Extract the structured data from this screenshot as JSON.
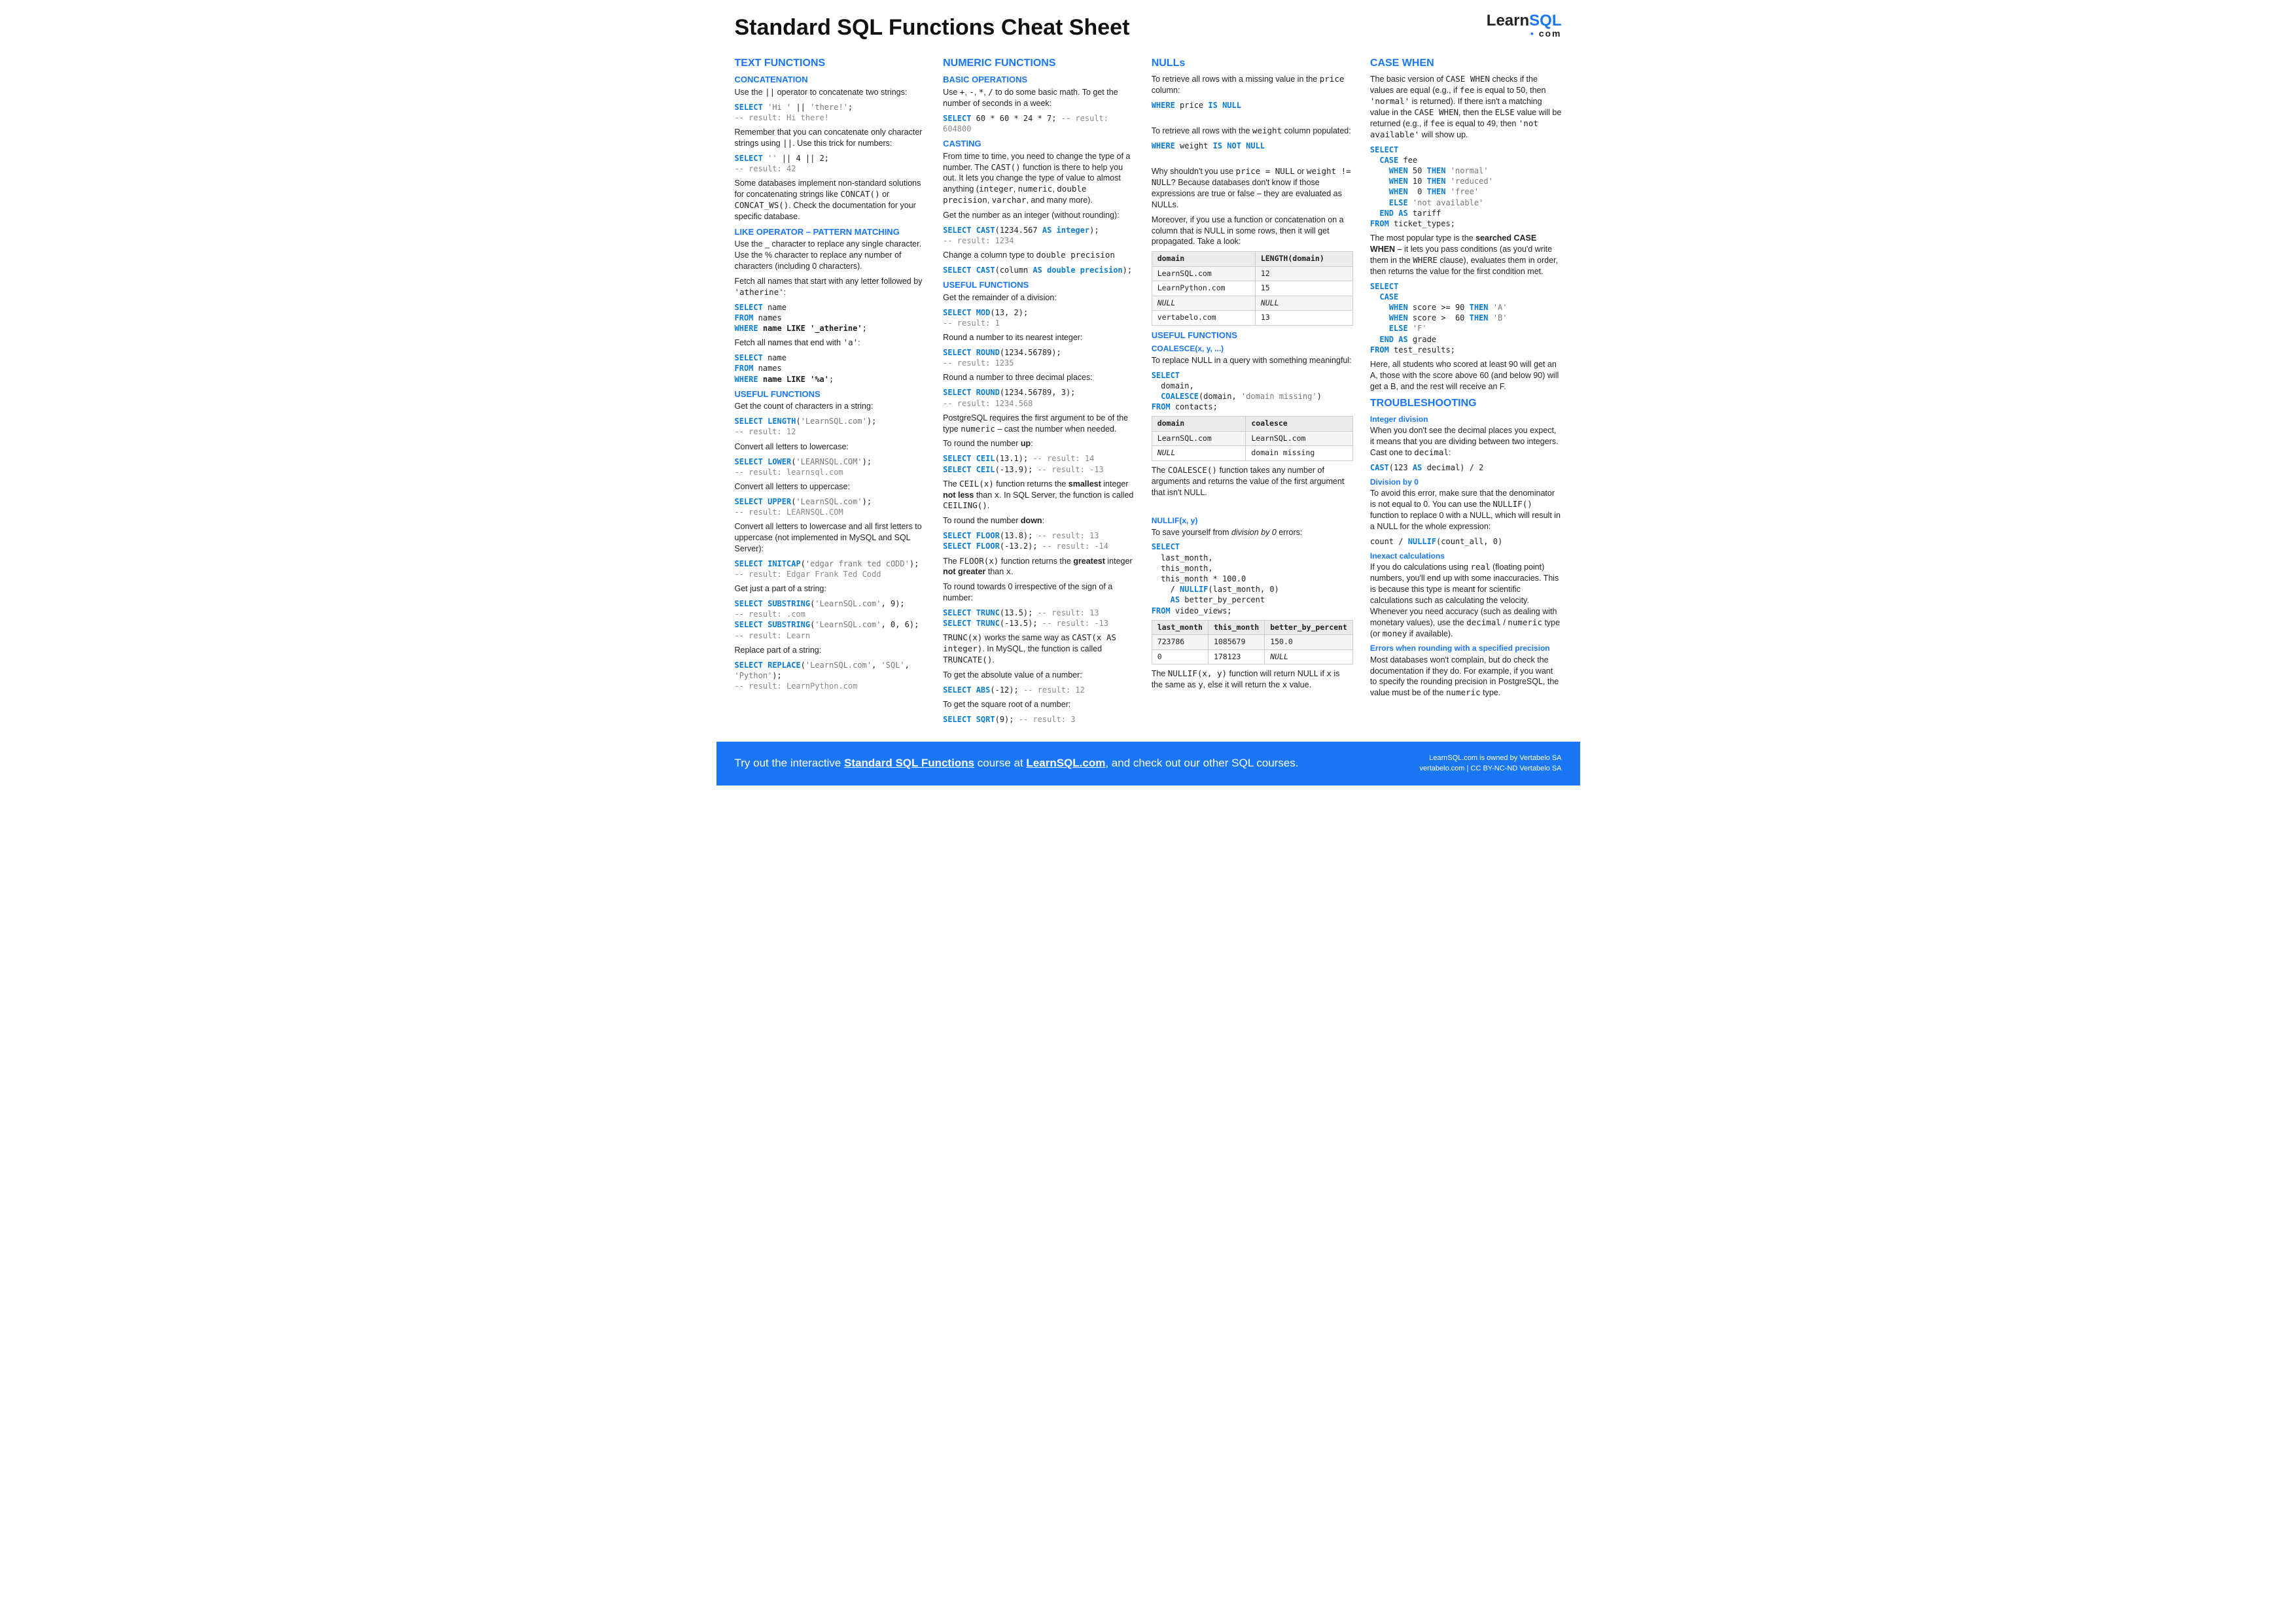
{
  "header": {
    "title": "Standard SQL Functions Cheat Sheet",
    "logo_main_pre": "Learn",
    "logo_main_blue": "SQL",
    "logo_sub": "com"
  },
  "col1": {
    "h_text": "TEXT FUNCTIONS",
    "h_concat": "CONCATENATION",
    "concat_p1": "Use the || operator to concatenate two strings:",
    "concat_code1": "SELECT 'Hi ' || 'there!';\n-- result: Hi there!",
    "concat_p2a": "Remember that you can concatenate only character strings using ",
    "concat_p2b": ". Use this trick for numbers:",
    "concat_code2": "SELECT '' || 4 || 2;\n-- result: 42",
    "concat_p3": "Some databases implement non-standard solutions for concatenating strings like CONCAT() or CONCAT_WS(). Check the documentation for your specific database.",
    "h_like": "LIKE OPERATOR – PATTERN MATCHING",
    "like_p1": "Use the _ character to replace any single character. Use the % character to replace any number of characters (including 0 characters).",
    "like_p2": "Fetch all names that start with any letter followed by 'atherine':",
    "like_code1": "SELECT name\nFROM names\nWHERE name LIKE '_atherine';",
    "like_p3": "Fetch all names that end with 'a':",
    "like_code2": "SELECT name\nFROM names\nWHERE name LIKE '%a';",
    "h_useful": "USEFUL FUNCTIONS",
    "u1_p": "Get the count of characters in a string:",
    "u1_c": "SELECT LENGTH('LearnSQL.com');\n-- result: 12",
    "u2_p": "Convert all letters to lowercase:",
    "u2_c": "SELECT LOWER('LEARNSQL.COM');\n-- result: learnsql.com",
    "u3_p": "Convert all letters to uppercase:",
    "u3_c": "SELECT UPPER('LearnSQL.com');\n-- result: LEARNSQL.COM",
    "u4_p": "Convert all letters to lowercase and all first letters to uppercase (not implemented in MySQL and SQL Server):",
    "u4_c": "SELECT INITCAP('edgar frank ted cODD');\n-- result: Edgar Frank Ted Codd",
    "u5_p": "Get just a part of a string:",
    "u5_c": "SELECT SUBSTRING('LearnSQL.com', 9);\n-- result: .com\nSELECT SUBSTRING('LearnSQL.com', 0, 6);\n-- result: Learn",
    "u6_p": "Replace part of a string:",
    "u6_c": "SELECT REPLACE('LearnSQL.com', 'SQL', 'Python');\n-- result: LearnPython.com"
  },
  "col2": {
    "h_num": "NUMERIC FUNCTIONS",
    "h_basic": "BASIC OPERATIONS",
    "basic_p": "Use +, -, *, / to do some basic math. To get the number of seconds in a week:",
    "basic_c": "SELECT 60 * 60 * 24 * 7; -- result: 604800",
    "h_cast": "CASTING",
    "cast_p1": "From time to time, you need to change the type of a number. The CAST() function is there to help you out. It lets you change the type of value to almost anything (integer, numeric, double precision, varchar, and many more).",
    "cast_p2": "Get the number as an integer (without rounding):",
    "cast_c1": "SELECT CAST(1234.567 AS integer);\n-- result: 1234",
    "cast_p3": "Change a column type to double precision",
    "cast_c2": "SELECT CAST(column AS double precision);",
    "h_useful": "USEFUL FUNCTIONS",
    "u1_p": "Get the remainder of a division:",
    "u1_c": "SELECT MOD(13, 2);\n-- result: 1",
    "u2_p": "Round a number to its nearest integer:",
    "u2_c": "SELECT ROUND(1234.56789);\n-- result: 1235",
    "u3_p": "Round a number to three decimal places:",
    "u3_c": "SELECT ROUND(1234.56789, 3);\n-- result: 1234.568",
    "u3_p2": "PostgreSQL requires the first argument to be of the type numeric – cast the number when needed.",
    "u4_p": "To round the number up:",
    "u4_c": "SELECT CEIL(13.1); -- result: 14\nSELECT CEIL(-13.9); -- result: -13",
    "u4_p2": "The CEIL(x) function returns the smallest integer not less than x. In SQL Server, the function is called CEILING().",
    "u5_p": "To round the number down:",
    "u5_c": "SELECT FLOOR(13.8); -- result: 13\nSELECT FLOOR(-13.2); -- result: -14",
    "u5_p2": "The FLOOR(x) function returns the greatest integer not greater than x.",
    "u6_p": "To round towards 0 irrespective of the sign of a number:",
    "u6_c": "SELECT TRUNC(13.5); -- result: 13\nSELECT TRUNC(-13.5); -- result: -13",
    "u6_p2": "TRUNC(x) works the same way as CAST(x AS integer). In MySQL, the function is called TRUNCATE().",
    "u7_p": "To get the absolute value of a number:",
    "u7_c": "SELECT ABS(-12); -- result: 12",
    "u8_p": "To get the square root of a number:",
    "u8_c": "SELECT SQRT(9); -- result: 3"
  },
  "col3": {
    "h_null": "NULLs",
    "n1_p": "To retrieve all rows with a missing value in the price column:",
    "n1_c": "WHERE price IS NULL",
    "n2_p": "To retrieve all rows with the weight column populated:",
    "n2_c": "WHERE weight IS NOT NULL",
    "n3_p": "Why shouldn't you use price = NULL or weight != NULL? Because databases don't know if those expressions are true or false – they are evaluated as NULLs.",
    "n4_p": "Moreover, if you use a function or concatenation on a column that is NULL in some rows, then it will get propagated. Take a look:",
    "table1": {
      "headers": [
        "domain",
        "LENGTH(domain)"
      ],
      "rows": [
        [
          "LearnSQL.com",
          "12"
        ],
        [
          "LearnPython.com",
          "15"
        ],
        [
          "NULL",
          "NULL"
        ],
        [
          "vertabelo.com",
          "13"
        ]
      ]
    },
    "h_useful": "USEFUL FUNCTIONS",
    "h_coalesce": "COALESCE(x, y, ...)",
    "co_p": "To replace NULL in a query with something meaningful:",
    "co_c": "SELECT\n  domain,\n  COALESCE(domain, 'domain missing')\nFROM contacts;",
    "table2": {
      "headers": [
        "domain",
        "coalesce"
      ],
      "rows": [
        [
          "LearnSQL.com",
          "LearnSQL.com"
        ],
        [
          "NULL",
          "domain missing"
        ]
      ]
    },
    "co_p2": "The COALESCE() function takes any number of arguments and returns the value of the first argument that isn't NULL.",
    "h_nullif": "NULLIF(x, y)",
    "ni_p": "To save yourself from division by 0 errors:",
    "ni_c": "SELECT\n  last_month,\n  this_month,\n  this_month * 100.0\n    / NULLIF(last_month, 0)\n    AS better_by_percent\nFROM video_views;",
    "table3": {
      "headers": [
        "last_month",
        "this_month",
        "better_by_percent"
      ],
      "rows": [
        [
          "723786",
          "1085679",
          "150.0"
        ],
        [
          "0",
          "178123",
          "NULL"
        ]
      ]
    },
    "ni_p2": "The NULLIF(x, y) function will return NULL if x is the same as y, else it will return the x value."
  },
  "col4": {
    "h_case": "CASE WHEN",
    "cw_p1": "The basic version of CASE WHEN checks if the values are equal (e.g., if fee is equal to 50, then 'normal' is returned). If there isn't a matching value in the CASE WHEN, then the ELSE value will be returned (e.g., if fee is equal to 49, then 'not available' will show up.",
    "cw_c1": "SELECT\n  CASE fee\n    WHEN 50 THEN 'normal'\n    WHEN 10 THEN 'reduced'\n    WHEN  0 THEN 'free'\n    ELSE 'not available'\n  END AS tariff\nFROM ticket_types;",
    "cw_p2": "The most popular type is the searched CASE WHEN – it lets you pass conditions (as you'd write them in the WHERE clause), evaluates them in order, then returns the value for the first condition met.",
    "cw_c2": "SELECT\n  CASE\n    WHEN score >= 90 THEN 'A'\n    WHEN score >  60 THEN 'B'\n    ELSE 'F'\n  END AS grade\nFROM test_results;",
    "cw_p3": "Here, all students who scored at least 90 will get an A, those with the score above 60 (and below 90) will get a B, and the rest will receive an F.",
    "h_trouble": "TROUBLESHOOTING",
    "t1_h": "Integer division",
    "t1_p": "When you don't see the decimal places you expect, it means that you are dividing between two integers. Cast one to decimal:",
    "t1_c": "CAST(123 AS decimal) / 2",
    "t2_h": "Division by 0",
    "t2_p": "To avoid this error, make sure that the denominator is not equal to 0. You can use the NULLIF() function to replace 0 with a NULL, which will result in a NULL for the whole expression:",
    "t2_c": "count / NULLIF(count_all, 0)",
    "t3_h": "Inexact calculations",
    "t3_p": "If you do calculations using real (floating point) numbers, you'll end up with some inaccuracies. This is because this type is meant for scientific calculations such as calculating the velocity. Whenever you need accuracy (such as dealing with monetary values), use the decimal / numeric type (or money if available).",
    "t4_h": "Errors when rounding with a specified precision",
    "t4_p": "Most databases won't complain, but do check the documentation if they do. For example, if you want to specify the rounding precision in PostgreSQL, the value must be of the numeric type."
  },
  "footer": {
    "left_pre": "Try out the interactive ",
    "left_link1": "Standard SQL Functions",
    "left_mid": " course at ",
    "left_link2": "LearnSQL.com",
    "left_post": ", and check out our other SQL courses.",
    "right1": "LearnSQL.com is owned by Vertabelo SA",
    "right2": "vertabelo.com | CC BY-NC-ND Vertabelo SA"
  }
}
